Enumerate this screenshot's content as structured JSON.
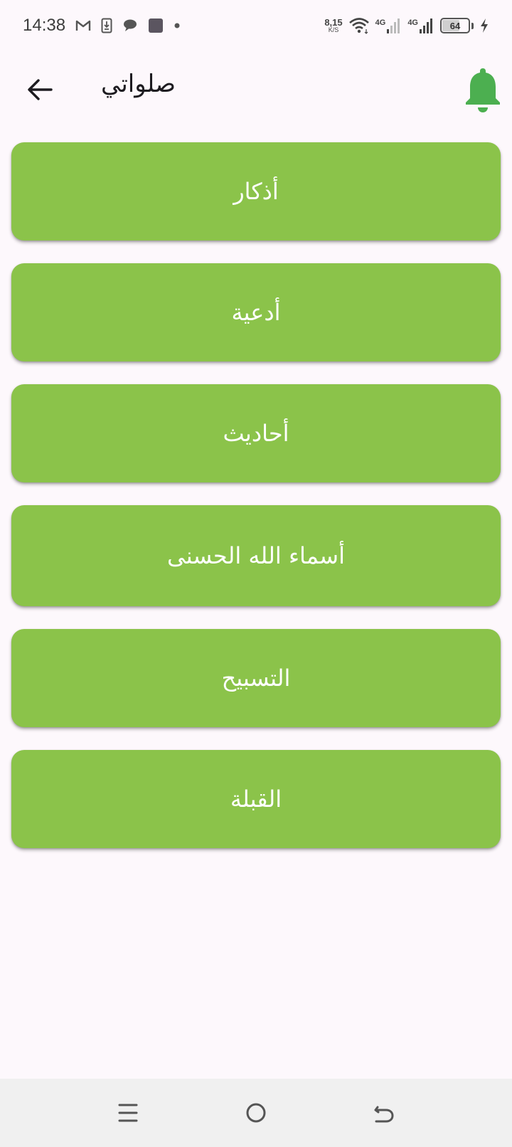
{
  "status_bar": {
    "time": "14:38",
    "net_speed_value": "8,15",
    "net_speed_unit": "K/S",
    "sim1_label": "4G",
    "sim2_label": "4G",
    "battery_level": "64",
    "battery_percent": 64,
    "icons": [
      "gmail-icon",
      "download-notification-icon",
      "chat-icon",
      "app-square-icon",
      "more-dot-icon",
      "wifi-icon",
      "signal-icon",
      "battery-icon",
      "charging-icon"
    ]
  },
  "app_bar": {
    "title": "صلواتي",
    "back_icon": "arrow-back-icon",
    "bell_icon": "bell-icon",
    "bell_color": "#4caf50"
  },
  "menu": {
    "items": [
      {
        "label": "أذكار"
      },
      {
        "label": "أدعية"
      },
      {
        "label": "أحاديث"
      },
      {
        "label": "أسماء الله الحسنى"
      },
      {
        "label": "التسبيح"
      },
      {
        "label": "القبلة"
      }
    ],
    "button_color": "#8bc34a",
    "text_color": "#ffffff"
  },
  "nav_bar": {
    "icons": [
      "recents-icon",
      "home-icon",
      "back-icon"
    ]
  }
}
